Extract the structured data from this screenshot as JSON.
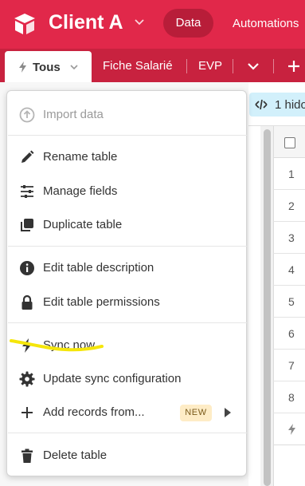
{
  "header": {
    "client_title": "Client A",
    "nav": [
      {
        "label": "Data",
        "active": true
      },
      {
        "label": "Automations",
        "active": false
      }
    ],
    "bg_color": "#e1284a"
  },
  "tabs": {
    "active": {
      "label": "Tous",
      "icon": "bolt-icon"
    },
    "items": [
      {
        "label": "Fiche Salarié"
      },
      {
        "label": "EVP"
      }
    ]
  },
  "view_toolbar": {
    "hidden_fields_label": "1 hido"
  },
  "grid": {
    "row_numbers": [
      "1",
      "2",
      "3",
      "4",
      "5",
      "6",
      "7",
      "8"
    ]
  },
  "menu": {
    "items": [
      {
        "label": "Import data",
        "icon": "import-icon",
        "disabled": true
      },
      {
        "label": "Rename table",
        "icon": "pencil-icon"
      },
      {
        "label": "Manage fields",
        "icon": "sliders-icon"
      },
      {
        "label": "Duplicate table",
        "icon": "duplicate-icon"
      },
      {
        "label": "Edit table description",
        "icon": "info-icon"
      },
      {
        "label": "Edit table permissions",
        "icon": "lock-icon"
      },
      {
        "label": "Sync now",
        "icon": "bolt-icon",
        "highlighted": true
      },
      {
        "label": "Update sync configuration",
        "icon": "gear-icon"
      },
      {
        "label": "Add records from...",
        "icon": "plus-icon",
        "badge": "NEW",
        "has_submenu": true
      },
      {
        "label": "Delete table",
        "icon": "trash-icon"
      }
    ],
    "highlight_color": "#f5e60a"
  }
}
